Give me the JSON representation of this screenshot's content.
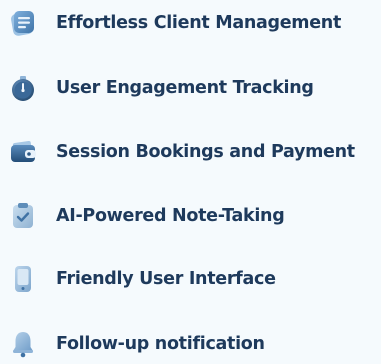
{
  "features": [
    {
      "label": "Effortless Client Management",
      "icon": "note-card-icon"
    },
    {
      "label": "User Engagement Tracking",
      "icon": "stopwatch-icon"
    },
    {
      "label": "Session Bookings and Payment",
      "icon": "wallet-icon"
    },
    {
      "label": "AI-Powered Note-Taking",
      "icon": "clipboard-check-icon"
    },
    {
      "label": "Friendly User Interface",
      "icon": "smartphone-icon"
    },
    {
      "label": "Follow-up notification",
      "icon": "bell-icon"
    }
  ],
  "colors": {
    "background": "#f5fafd",
    "text": "#1e3a5c",
    "icon_blue": "#5b8fbf",
    "icon_dark": "#2e5a86"
  }
}
